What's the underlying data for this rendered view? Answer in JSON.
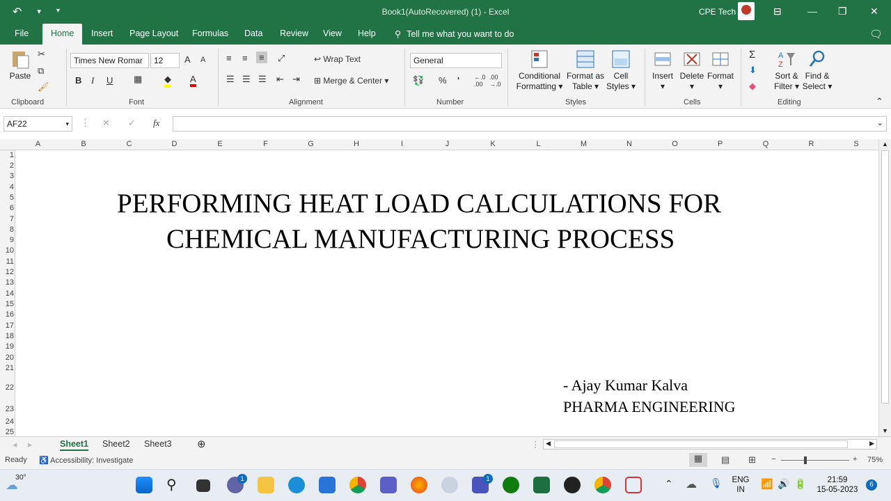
{
  "titlebar": {
    "title": "Book1(AutoRecovered) (1)  -  Excel",
    "user": "CPE Tech",
    "undo_icon": "undo-icon",
    "customize_icon": "customize-qat-icon"
  },
  "tabs": [
    "File",
    "Home",
    "Insert",
    "Page Layout",
    "Formulas",
    "Data",
    "Review",
    "View",
    "Help"
  ],
  "tellme": "Tell me what you want to do",
  "ribbon": {
    "clipboard": {
      "paste": "Paste",
      "label": "Clipboard"
    },
    "font": {
      "name": "Times New Romar",
      "size": "12",
      "label": "Font",
      "bold": "B",
      "italic": "I",
      "underline": "U"
    },
    "alignment": {
      "wrap": "Wrap Text",
      "merge": "Merge & Center",
      "label": "Alignment"
    },
    "number": {
      "format": "General",
      "label": "Number",
      "percent": "%",
      "comma": "'"
    },
    "styles": {
      "cond": "Conditional",
      "cond2": "Formatting",
      "table": "Format as",
      "table2": "Table",
      "cell": "Cell",
      "cell2": "Styles",
      "label": "Styles"
    },
    "cells": {
      "insert": "Insert",
      "delete": "Delete",
      "format": "Format",
      "label": "Cells"
    },
    "editing": {
      "sort": "Sort &",
      "sort2": "Filter",
      "find": "Find &",
      "find2": "Select",
      "label": "Editing",
      "sum": "Σ"
    }
  },
  "formula": {
    "namebox": "AF22",
    "fx": "fx",
    "value": ""
  },
  "columns": [
    "A",
    "B",
    "C",
    "D",
    "E",
    "F",
    "G",
    "H",
    "I",
    "J",
    "K",
    "L",
    "M",
    "N",
    "O",
    "P",
    "Q",
    "R",
    "S"
  ],
  "rows": [
    "1",
    "2",
    "3",
    "4",
    "5",
    "6",
    "7",
    "8",
    "9",
    "10",
    "11",
    "12",
    "13",
    "14",
    "15",
    "16",
    "17",
    "18",
    "19",
    "20",
    "21",
    "22",
    "23",
    "24",
    "25"
  ],
  "cells": {
    "title_line1": "PERFORMING HEAT LOAD CALCULATIONS FOR",
    "title_line2": "CHEMICAL MANUFACTURING PROCESS",
    "author": "- Ajay Kumar Kalva",
    "dept": "PHARMA ENGINEERING"
  },
  "sheets": [
    "Sheet1",
    "Sheet2",
    "Sheet3"
  ],
  "status": {
    "ready": "Ready",
    "accessibility": "Accessibility: Investigate",
    "zoom": "75%"
  },
  "taskbar": {
    "weather": "30°",
    "lang1": "ENG",
    "lang2": "IN",
    "time": "21:59",
    "date": "15-05-2023",
    "notif": "6",
    "teams_badge": "1",
    "t_badge": "1"
  },
  "colors": {
    "accent": "#217346",
    "taskbar": "#e8edf4"
  }
}
